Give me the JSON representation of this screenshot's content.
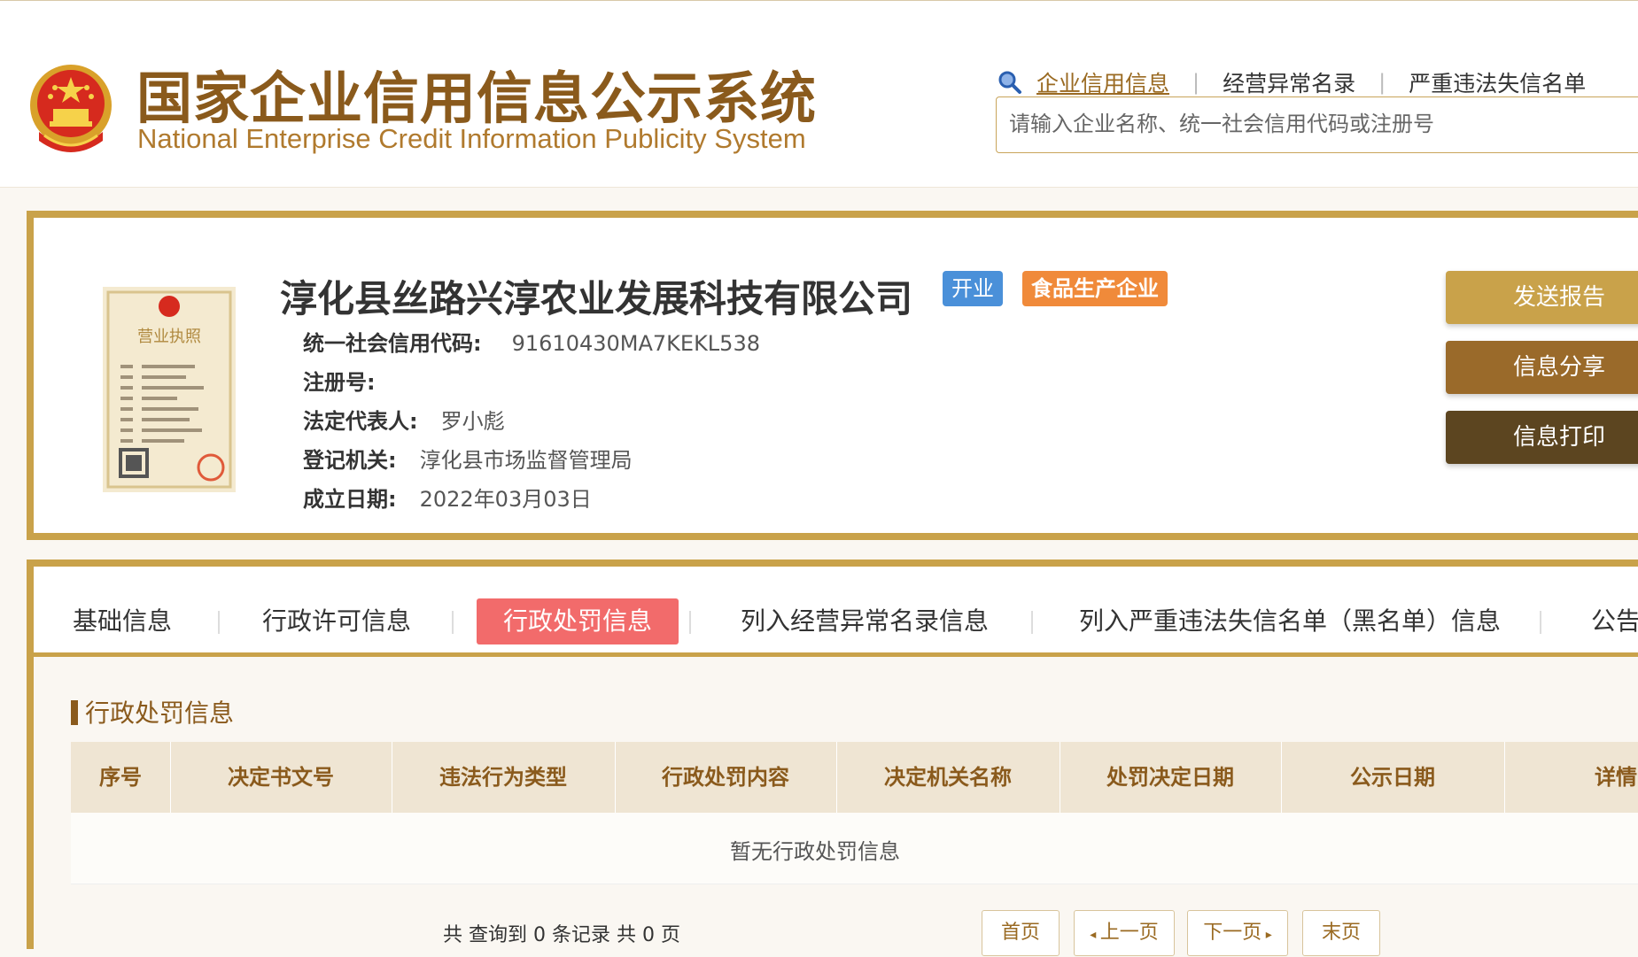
{
  "header": {
    "title_cn": "国家企业信用信息公示系统",
    "title_en": "National Enterprise Credit Information Publicity System",
    "nav": [
      {
        "label": "企业信用信息",
        "active": true
      },
      {
        "label": "经营异常名录",
        "active": false
      },
      {
        "label": "严重违法失信名单",
        "active": false
      }
    ],
    "search_placeholder": "请输入企业名称、统一社会信用代码或注册号"
  },
  "company": {
    "name": "淳化县丝路兴淳农业发展科技有限公司",
    "status_badge": "开业",
    "type_badge": "食品生产企业",
    "license_title": "营业执照",
    "fields": [
      {
        "label": "统一社会信用代码:",
        "value": "91610430MA7KEKL538"
      },
      {
        "label": "注册号:",
        "value": ""
      },
      {
        "label": "法定代表人:",
        "value": "罗小彪"
      },
      {
        "label": "登记机关:",
        "value": "淳化县市场监督管理局"
      },
      {
        "label": "成立日期:",
        "value": "2022年03月03日"
      }
    ]
  },
  "actions": [
    {
      "label": "发送报告",
      "color": "#c9a24a"
    },
    {
      "label": "信息分享",
      "color": "#9a6a2a"
    },
    {
      "label": "信息打印",
      "color": "#5c4520"
    }
  ],
  "tabs": [
    {
      "label": "基础信息",
      "active": false
    },
    {
      "label": "行政许可信息",
      "active": false
    },
    {
      "label": "行政处罚信息",
      "active": true
    },
    {
      "label": "列入经营异常名录信息",
      "active": false
    },
    {
      "label": "列入严重违法失信名单（黑名单）信息",
      "active": false
    },
    {
      "label": "公告",
      "active": false
    }
  ],
  "section": {
    "title": "行政处罚信息",
    "columns": [
      "序号",
      "决定书文号",
      "违法行为类型",
      "行政处罚内容",
      "决定机关名称",
      "处罚决定日期",
      "公示日期",
      "详情"
    ],
    "empty_message": "暂无行政处罚信息"
  },
  "pager": {
    "summary": "共 查询到 0 条记录 共 0 页",
    "first": "首页",
    "prev": "上一页",
    "next": "下一页",
    "last": "末页"
  },
  "colors": {
    "gold": "#c9a24a",
    "brown": "#8a5a1c",
    "active_tab": "#f26b6b",
    "status_blue": "#4a90d9",
    "type_orange": "#f08a3a"
  }
}
